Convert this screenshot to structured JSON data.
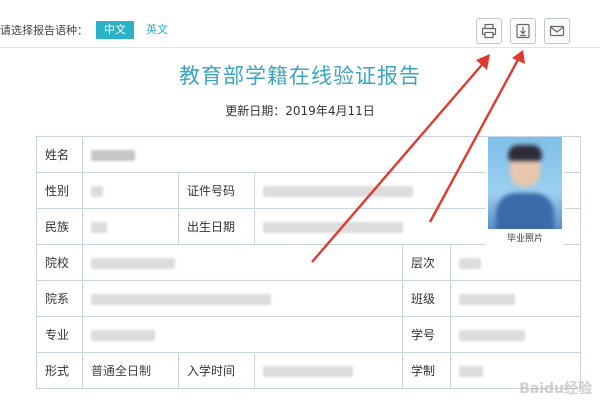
{
  "header": {
    "language_label": "请选择报告语种：",
    "lang_chinese": "中文",
    "lang_english": "英文"
  },
  "toolbar": {
    "print_icon": "printer-icon",
    "download_icon": "download-icon",
    "email_icon": "email-icon"
  },
  "report": {
    "title": "教育部学籍在线验证报告",
    "update_label": "更新日期：",
    "update_date": "2019年4月11日"
  },
  "table": {
    "name_label": "姓名",
    "gender_label": "性别",
    "id_type_label": "证件号码",
    "ethnicity_label": "民族",
    "birth_label": "出生日期",
    "school_label": "院校",
    "level_label": "层次",
    "department_label": "院系",
    "class_label": "班级",
    "major_label": "专业",
    "student_no_label": "学号",
    "form_label": "形式",
    "form_value": "普通全日制",
    "enroll_label": "入学时间",
    "duration_label": "学制"
  },
  "photo": {
    "caption": "毕业照片"
  },
  "watermark": "Baidu经验",
  "colors": {
    "accent": "#2bb2c7",
    "title": "#3aa6c2",
    "arrow": "#e03a2f",
    "border": "#c9d6df"
  }
}
